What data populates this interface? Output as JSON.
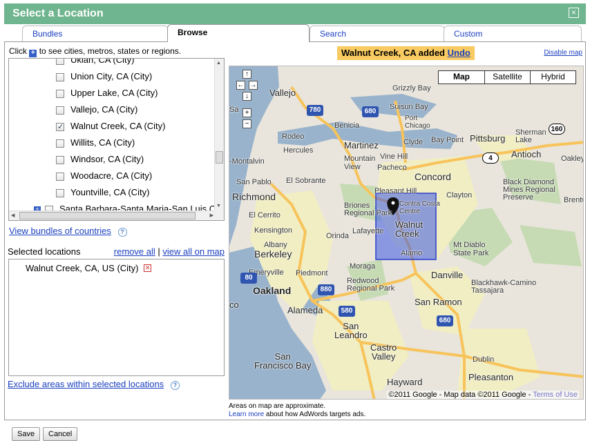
{
  "dialog": {
    "title": "Select a Location",
    "close_icon": "×"
  },
  "tabs": [
    {
      "label": "Bundles"
    },
    {
      "label": "Browse"
    },
    {
      "label": "Search"
    },
    {
      "label": "Custom"
    }
  ],
  "browse": {
    "click_hint_pre": "Click",
    "click_hint_post": "to see cities, metros, states or regions.",
    "tree_items": [
      {
        "label": "Ukiah, CA (City)",
        "checked": false
      },
      {
        "label": "Union City, CA (City)",
        "checked": false
      },
      {
        "label": "Upper Lake, CA (City)",
        "checked": false
      },
      {
        "label": "Vallejo, CA (City)",
        "checked": false
      },
      {
        "label": "Walnut Creek, CA (City)",
        "checked": true
      },
      {
        "label": "Willits, CA (City)",
        "checked": false
      },
      {
        "label": "Windsor, CA (City)",
        "checked": false
      },
      {
        "label": "Woodacre, CA (City)",
        "checked": false
      },
      {
        "label": "Yountville, CA (City)",
        "checked": false
      }
    ],
    "parent_item": "Santa Barbara-Santa Maria-San Luis O",
    "bundles_link": "View bundles of countries",
    "help_glyph": "?"
  },
  "selected": {
    "header": "Selected locations",
    "remove_all": "remove all",
    "separator": "|",
    "view_all": "view all on map",
    "items": [
      "Walnut Creek, CA, US (City)"
    ],
    "exclude_link": "Exclude areas within selected locations"
  },
  "map": {
    "banner_text": "Walnut Creek, CA added",
    "undo": "Undo",
    "disable_map": "Disable map",
    "types": [
      "Map",
      "Satellite",
      "Hybrid"
    ],
    "active_type": "Map",
    "attribution": "©2011 Google - Map data ©2011 Google -",
    "terms": "Terms of Use",
    "note_line1": "Areas on map are approximate.",
    "learn_more": "Learn more",
    "note_line2": "about how AdWords targets ads.",
    "labels": {
      "vallejo": "Vallejo",
      "grizzly_bay": "Grizzly Bay",
      "suisun_bay": "Suisun Bay",
      "port_chicago": "Port\nChicago",
      "benicia": "Benicia",
      "rodeo": "Rodeo",
      "clyde": "Clyde",
      "bay_point": "Bay Point",
      "pittsburg": "Pittsburg",
      "sherman_lake": "Sherman\nLake",
      "antioch": "Antioch",
      "oakley": "Oakley",
      "martinez": "Martinez",
      "hercules": "Hercules",
      "mountain_view": "Mountain\nView",
      "vine_hill": "Vine Hill",
      "pacheco": "Pacheco",
      "concord": "Concord",
      "montalvin": "-Montalvin",
      "san_pablo": "San Pablo",
      "el_sobrante": "El Sobrante",
      "pleasant_hill": "Pleasant Hill",
      "clayton": "Clayton",
      "black_diamond": "Black Diamond\nMines Regional\nPreserve",
      "brentwood": "Brentw",
      "richmond": "Richmond",
      "briones": "Briones\nRegional Park",
      "contra_costa": "Contra Costa\nCentre",
      "walnut_creek": "Walnut\nCreek",
      "el_cerrito": "El Cerrito",
      "kensington": "Kensington",
      "orinda": "Orinda",
      "lafayette": "Lafayette",
      "mt_diablo": "Mt Diablo\nState Park",
      "albany": "Albany",
      "berkeley": "Berkeley",
      "alamo": "Alamo",
      "emeryville": "Emeryville",
      "piedmont": "Piedmont",
      "moraga": "Moraga",
      "danville": "Danville",
      "redwood": "Redwood\nRegional Park",
      "blackhawk": "Blackhawk-Camino\nTassajara",
      "oakland": "Oakland",
      "alameda": "Alameda",
      "san_ramon": "San Ramon",
      "san_leandro": "San\nLeandro",
      "castro_valley": "Castro\nValley",
      "sf_bay": "San\nFrancisco Bay",
      "hayward": "Hayward",
      "pleasanton": "Pleasanton",
      "dublin": "Dublin",
      "sa": "Sa",
      "co": "co"
    },
    "shields": {
      "i780": "780",
      "i680a": "680",
      "s160": "160",
      "s4": "4",
      "i580": "580",
      "i680b": "680",
      "i880": "880",
      "i80": "80"
    }
  },
  "footer": {
    "save": "Save",
    "cancel": "Cancel"
  }
}
